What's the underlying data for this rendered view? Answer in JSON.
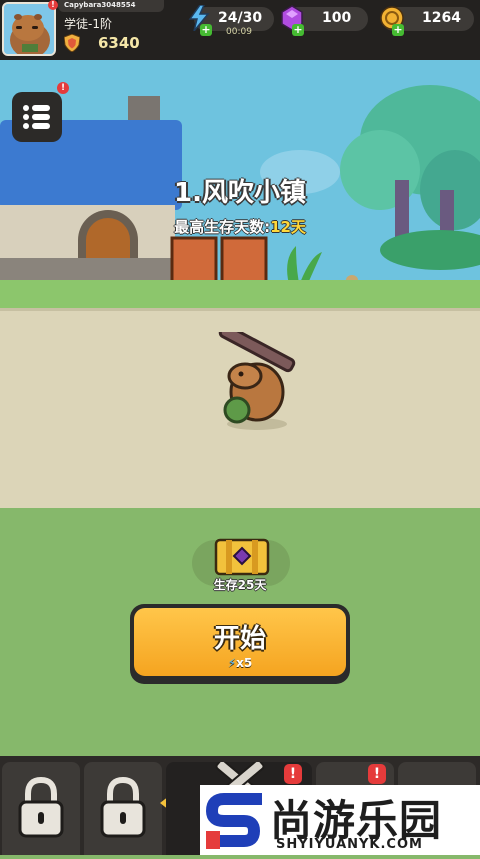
{
  "player": {
    "name": "Capybara3048554",
    "rank": "学徒-1阶",
    "power": "6340",
    "name_alert": "!"
  },
  "resources": {
    "energy": "24/30",
    "energy_timer": "00:09",
    "gems": "100",
    "gold": "1264",
    "plus": "+"
  },
  "menu": {
    "alert": "!"
  },
  "stage": {
    "title": "1.风吹小镇",
    "best_days_prefix": "最高生存天数:",
    "best_days_value": "12天"
  },
  "reward": {
    "label": "生存25天"
  },
  "start": {
    "label": "开始",
    "cost": "x5"
  },
  "nav": {
    "alert": "!"
  },
  "watermark": {
    "cn": "尚游乐园",
    "en": "SHYIYUANYK.COM"
  },
  "colors": {
    "hud": "#23211f",
    "start_button": "#f5a420",
    "alert": "#e53b3b",
    "days_highlight": "#ffd83a"
  }
}
